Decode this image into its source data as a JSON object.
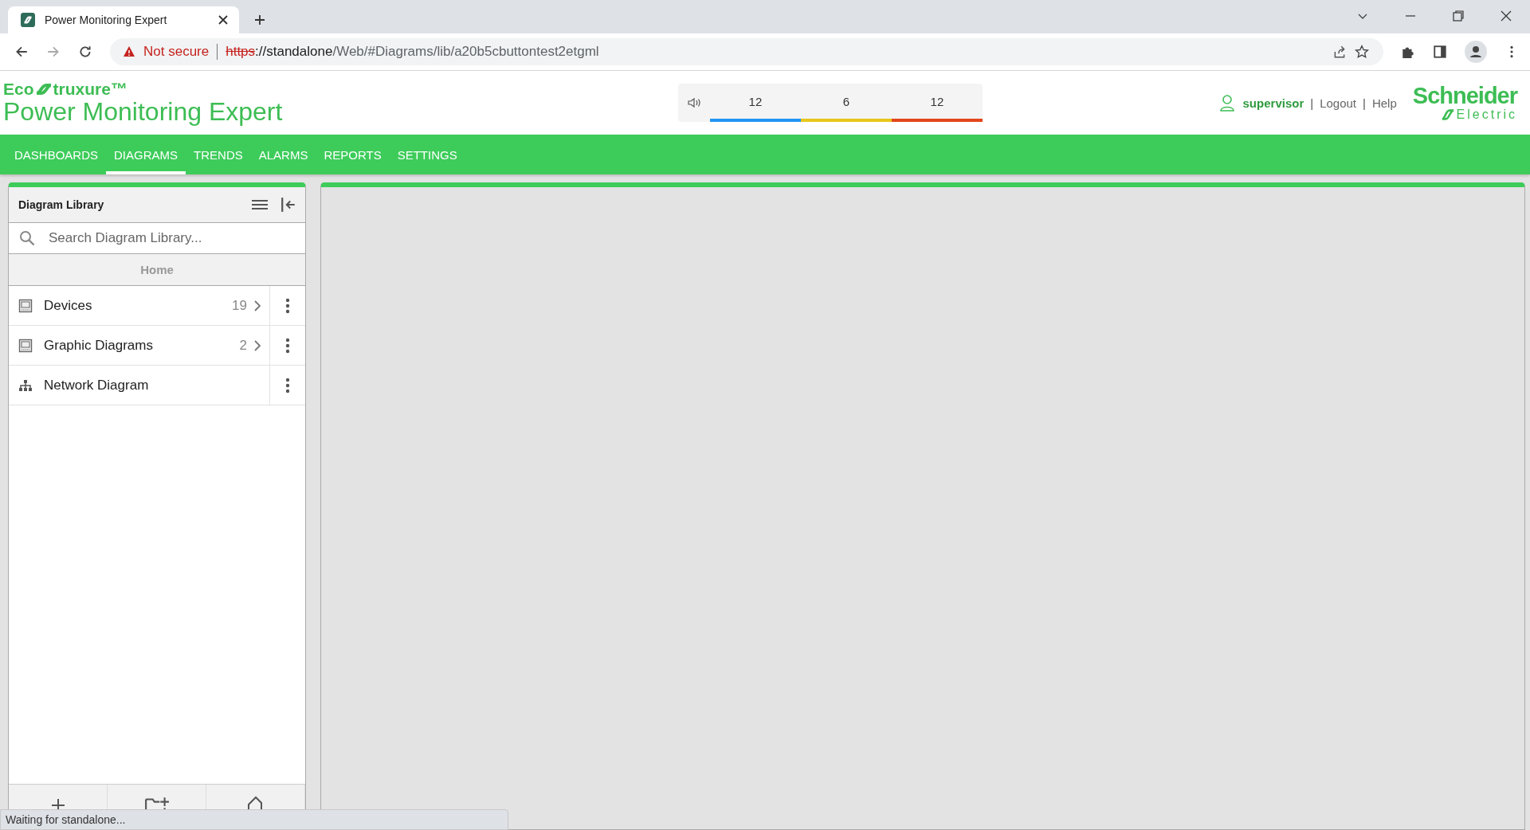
{
  "browser": {
    "tab_title": "Power Monitoring Expert",
    "security_label": "Not secure",
    "url_scheme": "https",
    "url_host": "://standalone",
    "url_path": "/Web/#Diagrams/lib/a20b5cbuttontest2etgml"
  },
  "header": {
    "brand_prefix": "Eco",
    "brand_suffix": "truxure™",
    "product": "Power Monitoring Expert",
    "alarm_counts": [
      {
        "count": "12",
        "color": "#2196f3"
      },
      {
        "count": "6",
        "color": "#e8c61a"
      },
      {
        "count": "12",
        "color": "#e2461a"
      }
    ],
    "user": "supervisor",
    "links": [
      {
        "separator": "|",
        "label": "Logout"
      },
      {
        "separator": "|",
        "label": "Help"
      }
    ],
    "vendor_top": "Schneider",
    "vendor_bottom": "Electric"
  },
  "nav": [
    {
      "label": "DASHBOARDS",
      "selected": false
    },
    {
      "label": "DIAGRAMS",
      "selected": true
    },
    {
      "label": "TRENDS",
      "selected": false
    },
    {
      "label": "ALARMS",
      "selected": false
    },
    {
      "label": "REPORTS",
      "selected": false
    },
    {
      "label": "SETTINGS",
      "selected": false
    }
  ],
  "library": {
    "title": "Diagram Library",
    "search": {
      "placeholder": "Search Diagram Library..."
    },
    "breadcrumb": "Home",
    "items": [
      {
        "kind": "folder",
        "name": "Devices",
        "count": "19"
      },
      {
        "kind": "folder",
        "name": "Graphic Diagrams",
        "count": "2"
      },
      {
        "kind": "network",
        "name": "Network Diagram"
      }
    ]
  },
  "status_bubble": "Waiting for standalone..."
}
